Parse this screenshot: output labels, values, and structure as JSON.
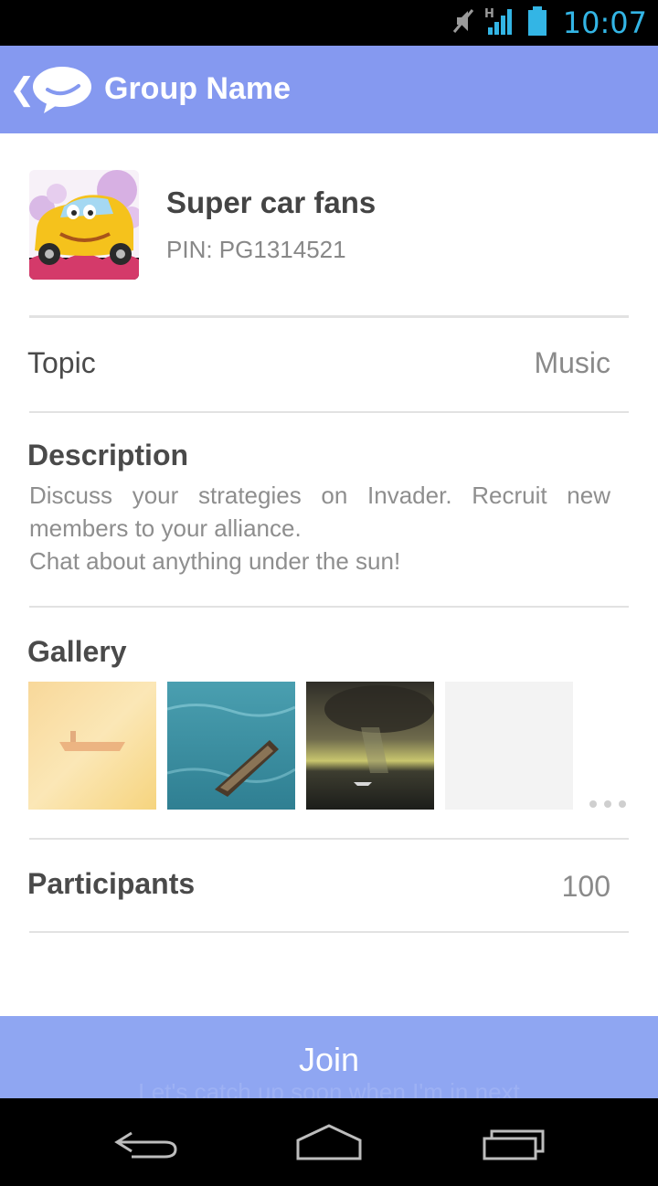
{
  "status_bar": {
    "time": "10:07",
    "network_indicator": "H",
    "icons": [
      "mute-icon",
      "signal-icon",
      "battery-icon"
    ]
  },
  "app_bar": {
    "title": "Group Name",
    "back_icon": "chevron-left-icon",
    "logo_icon": "chat-bubble-icon",
    "background_color": "#8599f0"
  },
  "group": {
    "name": "Super car fans",
    "pin": "PIN: PG1314521"
  },
  "topic": {
    "label": "Topic",
    "value": "Music"
  },
  "description": {
    "title": "Description",
    "lines": [
      "Discuss your strategies on Invader. Recruit new",
      "members to your alliance.",
      "Chat about anything under the sun!"
    ]
  },
  "gallery": {
    "title": "Gallery",
    "more_icon": "more-dots-icon"
  },
  "participants": {
    "label": "Participants",
    "count": "100"
  },
  "join_button": {
    "label": "Join",
    "background_color": "#8fa6f2"
  },
  "composer_hint": "Let's catch up soon when I'm in next",
  "nav_bar": {
    "icons": [
      "back-icon",
      "home-icon",
      "recent-apps-icon"
    ]
  }
}
